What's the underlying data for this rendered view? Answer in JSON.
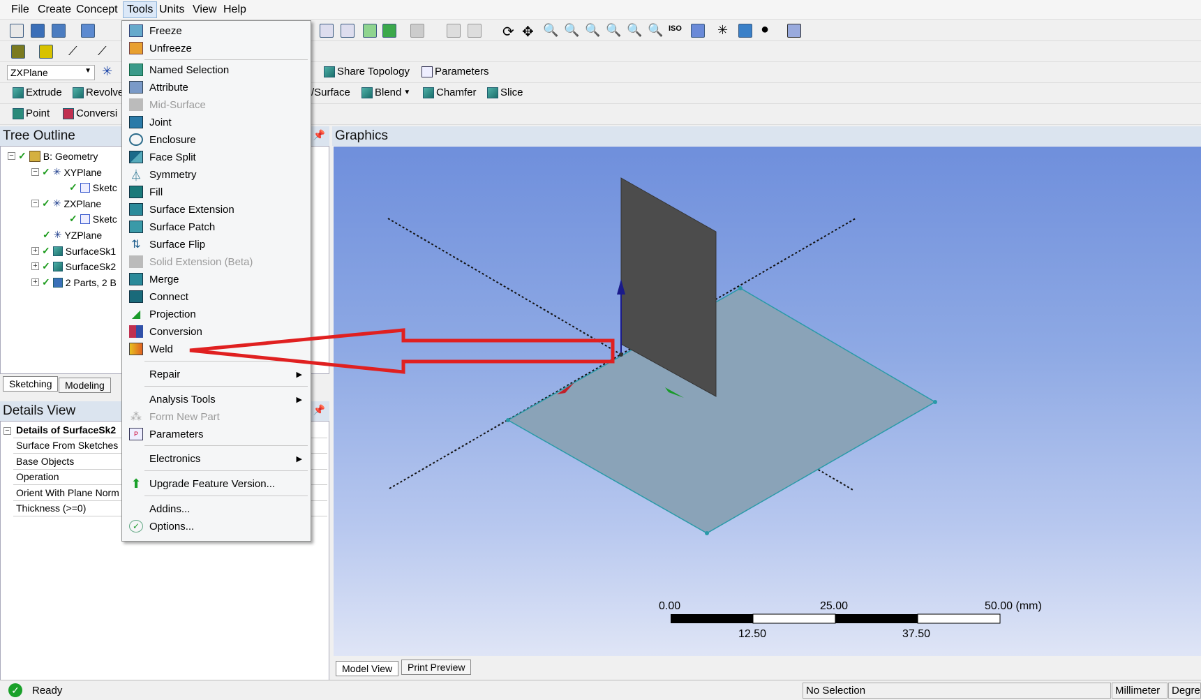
{
  "menubar": {
    "items": [
      "File",
      "Create",
      "Concept",
      "Tools",
      "Units",
      "View",
      "Help"
    ]
  },
  "toolbar": {
    "plane": "ZXPlane",
    "share_topology": "Share Topology",
    "parameters": "Parameters",
    "extrude": "Extrude",
    "revolve": "Revolve",
    "surface": "/Surface",
    "blend": "Blend",
    "chamfer": "Chamfer",
    "slice": "Slice",
    "point": "Point",
    "conversion": "Conversi"
  },
  "tree": {
    "title": "Tree Outline",
    "nodes": [
      {
        "label": "B: Geometry"
      },
      {
        "label": "XYPlane"
      },
      {
        "label": "Sketc"
      },
      {
        "label": "ZXPlane"
      },
      {
        "label": "Sketc"
      },
      {
        "label": "YZPlane"
      },
      {
        "label": "SurfaceSk1"
      },
      {
        "label": "SurfaceSk2"
      },
      {
        "label": "2 Parts, 2 B"
      }
    ],
    "tabs": [
      "Sketching",
      "Modeling"
    ]
  },
  "details": {
    "title": "Details View",
    "rows": [
      "Details of SurfaceSk2",
      "Surface From Sketches",
      "Base Objects",
      "Operation",
      "Orient With Plane Norm",
      "Thickness (>=0)"
    ]
  },
  "graphics": {
    "title": "Graphics",
    "tabs": [
      "Model View",
      "Print Preview"
    ],
    "scale": {
      "top": [
        "0.00",
        "25.00",
        "50.00 (mm)"
      ],
      "bottom": [
        "12.50",
        "37.50"
      ]
    }
  },
  "dropdown": {
    "items": [
      {
        "label": "Freeze",
        "icon": "freeze-icon"
      },
      {
        "label": "Unfreeze",
        "icon": "unfreeze-icon"
      },
      {
        "label": "Named Selection",
        "icon": "named-selection-icon"
      },
      {
        "label": "Attribute",
        "icon": "attribute-icon"
      },
      {
        "label": "Mid-Surface",
        "icon": "mid-surface-icon",
        "disabled": true
      },
      {
        "label": "Joint",
        "icon": "joint-icon"
      },
      {
        "label": "Enclosure",
        "icon": "enclosure-icon"
      },
      {
        "label": "Face Split",
        "icon": "face-split-icon"
      },
      {
        "label": "Symmetry",
        "icon": "symmetry-icon"
      },
      {
        "label": "Fill",
        "icon": "fill-icon"
      },
      {
        "label": "Surface Extension",
        "icon": "surface-extension-icon"
      },
      {
        "label": "Surface Patch",
        "icon": "surface-patch-icon"
      },
      {
        "label": "Surface Flip",
        "icon": "surface-flip-icon"
      },
      {
        "label": "Solid Extension (Beta)",
        "icon": "solid-extension-icon",
        "disabled": true
      },
      {
        "label": "Merge",
        "icon": "merge-icon"
      },
      {
        "label": "Connect",
        "icon": "connect-icon"
      },
      {
        "label": "Projection",
        "icon": "projection-icon"
      },
      {
        "label": "Conversion",
        "icon": "conversion-icon"
      },
      {
        "label": "Weld",
        "icon": "weld-icon"
      },
      {
        "label": "Repair",
        "submenu": true
      },
      {
        "label": "Analysis Tools",
        "submenu": true
      },
      {
        "label": "Form New Part",
        "icon": "form-new-part-icon",
        "disabled": true
      },
      {
        "label": "Parameters",
        "icon": "parameters-icon"
      },
      {
        "label": "Electronics",
        "submenu": true
      },
      {
        "label": "Upgrade Feature Version...",
        "icon": "upgrade-icon"
      },
      {
        "label": "Addins..."
      },
      {
        "label": "Options...",
        "icon": "options-icon"
      }
    ]
  },
  "status": {
    "ready": "Ready",
    "selection": "No Selection",
    "units": "Millimeter",
    "angle": "Degree"
  }
}
